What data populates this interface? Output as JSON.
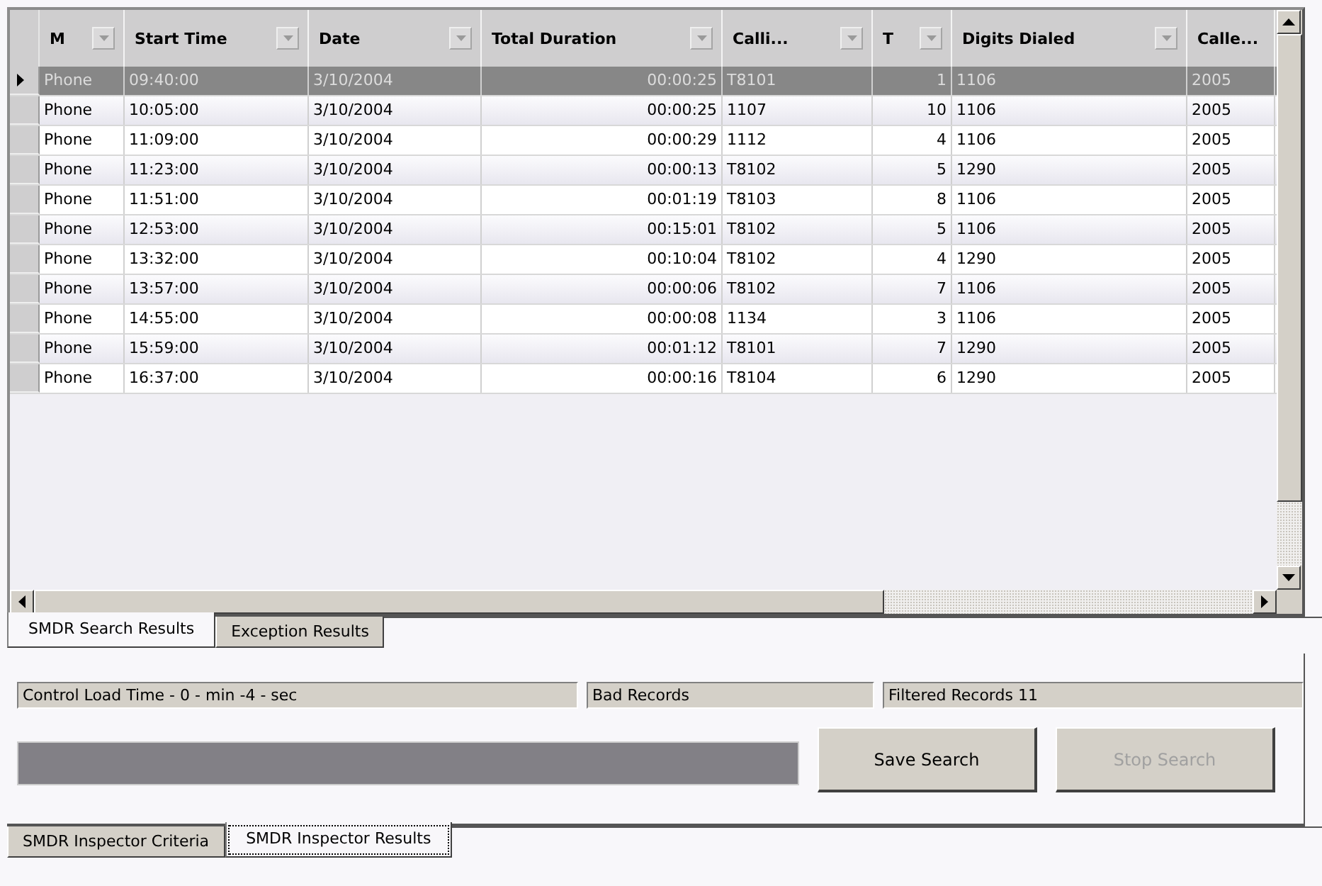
{
  "table": {
    "columns": [
      {
        "label": "M"
      },
      {
        "label": "Start Time"
      },
      {
        "label": "Date"
      },
      {
        "label": "Total Duration"
      },
      {
        "label": "Calli..."
      },
      {
        "label": "T"
      },
      {
        "label": "Digits Dialed"
      },
      {
        "label": "Calle..."
      }
    ],
    "rows": [
      {
        "selected": true,
        "cells": [
          "Phone",
          "09:40:00",
          "3/10/2004",
          "00:00:25",
          "T8101",
          "1",
          "1106",
          "2005"
        ]
      },
      {
        "selected": false,
        "cells": [
          "Phone",
          "10:05:00",
          "3/10/2004",
          "00:00:25",
          "1107",
          "10",
          "1106",
          "2005"
        ]
      },
      {
        "selected": false,
        "cells": [
          "Phone",
          "11:09:00",
          "3/10/2004",
          "00:00:29",
          "1112",
          "4",
          "1106",
          "2005"
        ]
      },
      {
        "selected": false,
        "cells": [
          "Phone",
          "11:23:00",
          "3/10/2004",
          "00:00:13",
          "T8102",
          "5",
          "1290",
          "2005"
        ]
      },
      {
        "selected": false,
        "cells": [
          "Phone",
          "11:51:00",
          "3/10/2004",
          "00:01:19",
          "T8103",
          "8",
          "1106",
          "2005"
        ]
      },
      {
        "selected": false,
        "cells": [
          "Phone",
          "12:53:00",
          "3/10/2004",
          "00:15:01",
          "T8102",
          "5",
          "1106",
          "2005"
        ]
      },
      {
        "selected": false,
        "cells": [
          "Phone",
          "13:32:00",
          "3/10/2004",
          "00:10:04",
          "T8102",
          "4",
          "1290",
          "2005"
        ]
      },
      {
        "selected": false,
        "cells": [
          "Phone",
          "13:57:00",
          "3/10/2004",
          "00:00:06",
          "T8102",
          "7",
          "1106",
          "2005"
        ]
      },
      {
        "selected": false,
        "cells": [
          "Phone",
          "14:55:00",
          "3/10/2004",
          "00:00:08",
          "1134",
          "3",
          "1106",
          "2005"
        ]
      },
      {
        "selected": false,
        "cells": [
          "Phone",
          "15:59:00",
          "3/10/2004",
          "00:01:12",
          "T8101",
          "7",
          "1290",
          "2005"
        ]
      },
      {
        "selected": false,
        "cells": [
          "Phone",
          "16:37:00",
          "3/10/2004",
          "00:00:16",
          "T8104",
          "6",
          "1290",
          "2005"
        ]
      }
    ]
  },
  "result_tabs": [
    {
      "label": "SMDR Search Results",
      "selected": true
    },
    {
      "label": "Exception Results",
      "selected": false
    }
  ],
  "status_fields": [
    "Control Load Time - 0 - min -4 - sec",
    "Bad Records",
    "Filtered Records 11"
  ],
  "progress": {
    "level": 1
  },
  "buttons": [
    {
      "label": "Save Search",
      "disabled": false
    },
    {
      "label": "Stop Search",
      "disabled": true
    }
  ],
  "main_tabs": [
    {
      "label": "SMDR Inspector Criteria",
      "selected": false
    },
    {
      "label": "SMDR Inspector Results",
      "selected": true
    }
  ]
}
